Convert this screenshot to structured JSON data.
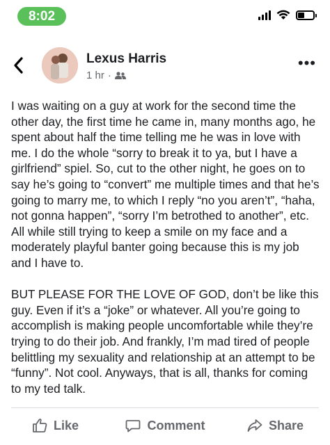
{
  "status_bar": {
    "time": "8:02",
    "signal_icon": "cellular-signal-icon",
    "wifi_icon": "wifi-icon",
    "battery_icon": "battery-icon",
    "accent_color": "#5ac05a"
  },
  "post": {
    "author": "Lexus Harris",
    "timestamp": "1 hr",
    "separator": "·",
    "audience_icon": "friends-icon",
    "paragraphs": [
      "I was waiting on a guy at work for the second time the other day, the first time he came in, many months ago, he spent about half the time telling me he was in love with me. I do the whole “sorry to break it to ya, but I have a girlfriend” spiel. So, cut to the other night, he goes on to say he’s going to “convert” me multiple times and that he’s going to marry me, to which I reply “no you aren’t”, “haha, not gonna happen”, “sorry I’m betrothed to another”, etc. All while still trying to keep a smile on my face and a moderately playful banter going because this is my job and I have to.",
      "BUT PLEASE FOR THE LOVE OF GOD, don’t be like this guy. Even if it’s a “joke” or whatever. All you’re going to accomplish is making people uncomfortable while they’re trying to do their job. And frankly, I’m mad tired of people belittling my sexuality and relationship at an attempt to be “funny”. Not cool. Anyways, that is all, thanks for coming to my ted talk."
    ]
  },
  "actions": {
    "like": "Like",
    "comment": "Comment",
    "share": "Share"
  },
  "header_icons": {
    "back": "back-chevron-icon",
    "more": "more-options-icon"
  },
  "more_glyph": "•••",
  "back_glyph": "‹"
}
